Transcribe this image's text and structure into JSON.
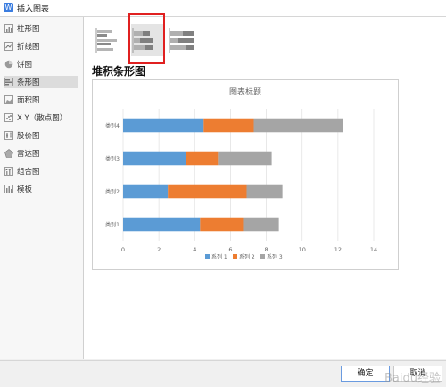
{
  "window": {
    "title": "插入图表",
    "app_icon": "W"
  },
  "sidebar": {
    "items": [
      {
        "label": "柱形图",
        "icon": "column-chart-icon"
      },
      {
        "label": "折线图",
        "icon": "line-chart-icon"
      },
      {
        "label": "饼图",
        "icon": "pie-chart-icon"
      },
      {
        "label": "条形图",
        "icon": "bar-chart-icon",
        "active": true
      },
      {
        "label": "面积图",
        "icon": "area-chart-icon"
      },
      {
        "label": "X Y（散点图）",
        "icon": "scatter-chart-icon"
      },
      {
        "label": "股价图",
        "icon": "stock-chart-icon"
      },
      {
        "label": "雷达图",
        "icon": "radar-chart-icon"
      },
      {
        "label": "组合图",
        "icon": "combo-chart-icon"
      },
      {
        "label": "模板",
        "icon": "template-icon"
      }
    ]
  },
  "main": {
    "subtypes": [
      {
        "icon": "clustered-bar-icon"
      },
      {
        "icon": "stacked-bar-icon",
        "selected": true
      },
      {
        "icon": "percent-stacked-bar-icon"
      }
    ],
    "chart_heading": "堆积条形图"
  },
  "chart_data": {
    "type": "bar",
    "orientation": "horizontal",
    "stacked": true,
    "title": "图表标题",
    "categories": [
      "类别1",
      "类别2",
      "类别3",
      "类别4"
    ],
    "series": [
      {
        "name": "系列 1",
        "values": [
          4.3,
          2.5,
          3.5,
          4.5
        ],
        "color": "#5b9bd5"
      },
      {
        "name": "系列 2",
        "values": [
          2.4,
          4.4,
          1.8,
          2.8
        ],
        "color": "#ed7d31"
      },
      {
        "name": "系列 3",
        "values": [
          2,
          2,
          3,
          5
        ],
        "color": "#a5a5a5"
      }
    ],
    "xlim": [
      0,
      14
    ],
    "xticks": [
      "0",
      "2",
      "4",
      "6",
      "8",
      "10",
      "12",
      "14"
    ],
    "grid": true,
    "legend_position": "bottom"
  },
  "footer": {
    "ok_label": "确定",
    "cancel_label": "取消"
  },
  "watermark": "Baidu经验"
}
